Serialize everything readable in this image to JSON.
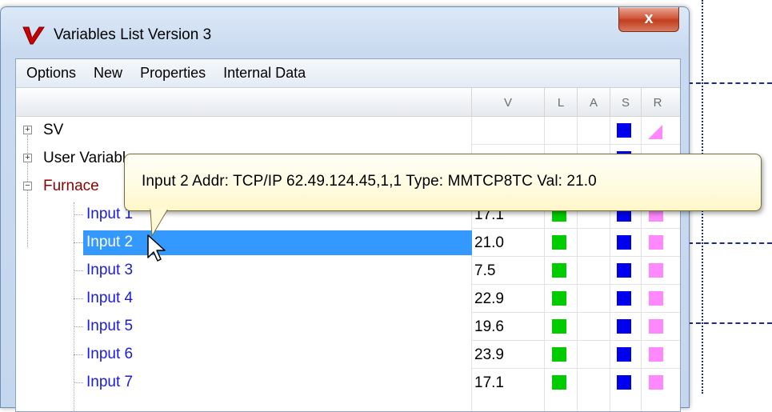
{
  "window": {
    "title": "Variables List Version 3",
    "close_label": "x"
  },
  "menu": [
    "Options",
    "New",
    "Properties",
    "Internal Data"
  ],
  "columns": {
    "name": "",
    "value": "V",
    "l": "L",
    "a": "A",
    "s": "S",
    "r": "R"
  },
  "groups": [
    {
      "expander": "+",
      "label": "SV",
      "color": "#000000"
    },
    {
      "expander": "+",
      "label": "User Variables",
      "color": "#000000"
    },
    {
      "expander": "−",
      "label": "Furnace",
      "color": "#8b0000"
    }
  ],
  "inputs": [
    {
      "label": "Input 1",
      "value": "17.1"
    },
    {
      "label": "Input 2",
      "value": "21.0",
      "selected": true
    },
    {
      "label": "Input 3",
      "value": "7.5"
    },
    {
      "label": "Input 4",
      "value": "22.9"
    },
    {
      "label": "Input 5",
      "value": "19.6"
    },
    {
      "label": "Input 6",
      "value": "23.9"
    },
    {
      "label": "Input 7",
      "value": "17.1"
    }
  ],
  "indicator_colors": {
    "L": "#00cc00",
    "S": "#0000ee",
    "R": "#ff88ff"
  },
  "tooltip": {
    "text": "Input 2 Addr: TCP/IP 62.49.124.45,1,1 Type: MMTCP8TC Val: 21.0"
  }
}
